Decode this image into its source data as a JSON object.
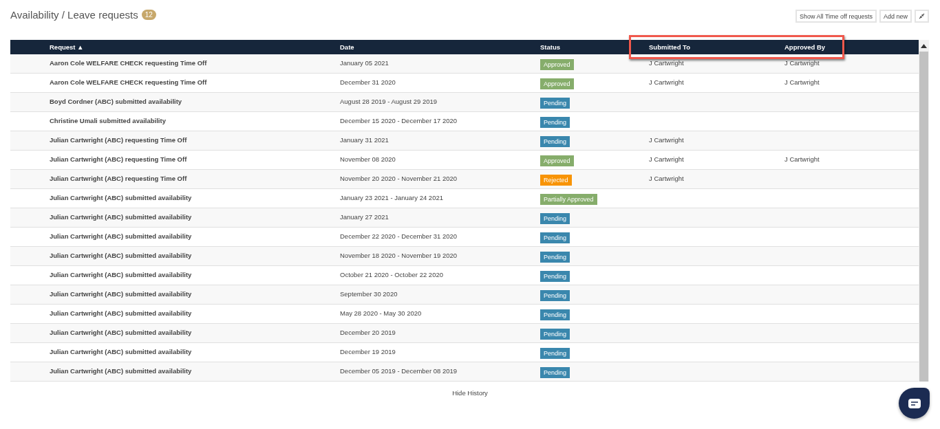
{
  "header": {
    "title": "Availability / Leave requests",
    "count": "12"
  },
  "toolbar": {
    "buttons": [
      "Show All Time off requests",
      "Add new"
    ]
  },
  "table": {
    "columns": [
      {
        "label": "Request ▲",
        "highlighted": false
      },
      {
        "label": "Date",
        "highlighted": false
      },
      {
        "label": "Status",
        "highlighted": false
      },
      {
        "label": "Submitted To",
        "highlighted": true
      },
      {
        "label": "Approved By",
        "highlighted": true
      }
    ],
    "rows": [
      {
        "request": "Aaron Cole WELFARE CHECK requesting Time Off",
        "date": "January 05 2021",
        "status": "Approved",
        "color": "#86ad6b",
        "submitted_to": "J Cartwright",
        "approved_by": "J Cartwright"
      },
      {
        "request": "Aaron Cole WELFARE CHECK requesting Time Off",
        "date": "December 31 2020",
        "status": "Approved",
        "color": "#86ad6b",
        "submitted_to": "J Cartwright",
        "approved_by": "J Cartwright"
      },
      {
        "request": "Boyd Cordner (ABC) submitted availability",
        "date": "August 28 2019 - August 29 2019",
        "status": "Pending",
        "color": "#3a87ad"
      },
      {
        "request": "Christine Umali submitted availability",
        "date": "December 15 2020 - December 17 2020",
        "status": "Pending",
        "color": "#3a87ad"
      },
      {
        "request": "Julian Cartwright (ABC) requesting Time Off",
        "date": "January 31 2021",
        "status": "Pending",
        "color": "#3a87ad",
        "submitted_to": "J Cartwright"
      },
      {
        "request": "Julian Cartwright (ABC) requesting Time Off",
        "date": "November 08 2020",
        "status": "Approved",
        "color": "#86ad6b",
        "submitted_to": "J Cartwright",
        "approved_by": "J Cartwright"
      },
      {
        "request": "Julian Cartwright (ABC) requesting Time Off",
        "date": "November 20 2020 - November 21 2020",
        "status": "Rejected",
        "color": "#f89406",
        "submitted_to": "J Cartwright"
      },
      {
        "request": "Julian Cartwright (ABC) submitted availability",
        "date": "January 23 2021 - January 24 2021",
        "status": "Partially Approved",
        "color": "#86ad6b"
      },
      {
        "request": "Julian Cartwright (ABC) submitted availability",
        "date": "January 27 2021",
        "status": "Pending",
        "color": "#3a87ad"
      },
      {
        "request": "Julian Cartwright (ABC) submitted availability",
        "date": "December 22 2020 - December 31 2020",
        "status": "Pending",
        "color": "#3a87ad"
      },
      {
        "request": "Julian Cartwright (ABC) submitted availability",
        "date": "November 18 2020 - November 19 2020",
        "status": "Pending",
        "color": "#3a87ad"
      },
      {
        "request": "Julian Cartwright (ABC) submitted availability",
        "date": "October 21 2020 - October 22 2020",
        "status": "Pending",
        "color": "#3a87ad"
      },
      {
        "request": "Julian Cartwright (ABC) submitted availability",
        "date": "September 30 2020",
        "status": "Pending",
        "color": "#3a87ad"
      },
      {
        "request": "Julian Cartwright (ABC) submitted availability",
        "date": "May 28 2020 - May 30 2020",
        "status": "Pending",
        "color": "#3a87ad"
      },
      {
        "request": "Julian Cartwright (ABC) submitted availability",
        "date": "December 20 2019",
        "status": "Pending",
        "color": "#3a87ad"
      },
      {
        "request": "Julian Cartwright (ABC) submitted availability",
        "date": "December 19 2019",
        "status": "Pending",
        "color": "#3a87ad"
      },
      {
        "request": "Julian Cartwright (ABC) submitted availability",
        "date": "December 05 2019 - December 08 2019",
        "status": "Pending",
        "color": "#3a87ad"
      }
    ]
  },
  "footer": {
    "link": "Hide History"
  }
}
